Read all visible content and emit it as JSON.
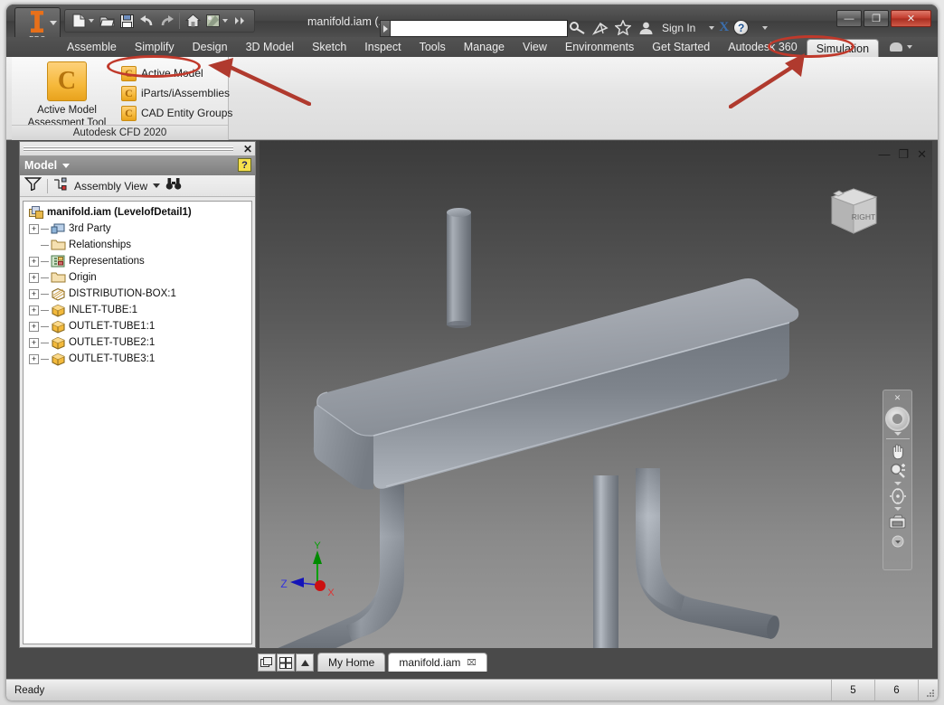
{
  "window": {
    "document_title": "manifold.iam (...",
    "app_button_label": "PRO",
    "minimize": "—",
    "maximize": "❐",
    "close": "✕"
  },
  "quick_access": {
    "items": [
      {
        "name": "new-file-icon",
        "label": "New"
      },
      {
        "name": "open-file-icon",
        "label": "Open"
      },
      {
        "name": "save-icon",
        "label": "Save"
      },
      {
        "name": "undo-icon",
        "label": "Undo"
      },
      {
        "name": "redo-icon",
        "label": "Redo"
      },
      {
        "name": "home-icon",
        "label": "Home"
      },
      {
        "name": "appearance-icon",
        "label": "Appearance"
      },
      {
        "name": "more-commands-icon",
        "label": "More"
      }
    ]
  },
  "search": {
    "value": "",
    "placeholder": ""
  },
  "toolbar_right": {
    "search_icon": "search-key-icon",
    "satellite_icon": "satellite-icon",
    "favorites_icon": "star-icon",
    "sign_in_label": "Sign In",
    "exchange_icon": "autodesk-exchange-icon",
    "help_label": "?"
  },
  "ribbon": {
    "tabs": [
      {
        "label": "Assemble",
        "active": false
      },
      {
        "label": "Simplify",
        "active": false
      },
      {
        "label": "Design",
        "active": false
      },
      {
        "label": "3D Model",
        "active": false
      },
      {
        "label": "Sketch",
        "active": false
      },
      {
        "label": "Inspect",
        "active": false
      },
      {
        "label": "Tools",
        "active": false
      },
      {
        "label": "Manage",
        "active": false
      },
      {
        "label": "View",
        "active": false
      },
      {
        "label": "Environments",
        "active": false
      },
      {
        "label": "Get Started",
        "active": false
      },
      {
        "label": "Autodesk 360",
        "active": false
      },
      {
        "label": "Simulation",
        "active": true
      }
    ],
    "panel": {
      "caption": "Autodesk CFD 2020",
      "big_button": {
        "label_line1": "Active Model",
        "label_line2": "Assessment Tool",
        "icon": "cfd-c-icon"
      },
      "small_buttons": [
        {
          "label": "Active Model",
          "icon": "cfd-c-icon"
        },
        {
          "label": "iParts/iAssemblies",
          "icon": "cfd-c-icon"
        },
        {
          "label": "CAD Entity Groups",
          "icon": "cfd-c-icon"
        }
      ]
    }
  },
  "browser": {
    "title": "Model",
    "help_label": "?",
    "close_label": "✕",
    "toolbar": {
      "filter_icon": "filter-funnel-icon",
      "view_label": "Assembly View",
      "view_icon": "assembly-view-icon",
      "find_icon": "binoculars-find-icon"
    },
    "tree": [
      {
        "label": "manifold.iam (LevelofDetail1)",
        "icon": "assembly-icon",
        "expandable": false,
        "root": true
      },
      {
        "label": "3rd Party",
        "icon": "third-party-icon",
        "expandable": true,
        "root": false
      },
      {
        "label": "Relationships",
        "icon": "folder-icon",
        "expandable": false,
        "root": false
      },
      {
        "label": "Representations",
        "icon": "representations-icon",
        "expandable": true,
        "root": false
      },
      {
        "label": "Origin",
        "icon": "folder-icon",
        "expandable": true,
        "root": false
      },
      {
        "label": "DISTRIBUTION-BOX:1",
        "icon": "part-shaded-icon",
        "expandable": true,
        "root": false
      },
      {
        "label": "INLET-TUBE:1",
        "icon": "part-icon",
        "expandable": true,
        "root": false
      },
      {
        "label": "OUTLET-TUBE1:1",
        "icon": "part-icon",
        "expandable": true,
        "root": false
      },
      {
        "label": "OUTLET-TUBE2:1",
        "icon": "part-icon",
        "expandable": true,
        "root": false
      },
      {
        "label": "OUTLET-TUBE3:1",
        "icon": "part-icon",
        "expandable": true,
        "root": false
      }
    ]
  },
  "viewport": {
    "window_buttons": {
      "minimize": "—",
      "restore": "❐",
      "close": "✕"
    },
    "viewcube_face": "RIGHT",
    "axis": {
      "x": "X",
      "y": "Y",
      "z": "Z"
    },
    "nav_bar": {
      "close_label": "✕",
      "items": [
        {
          "name": "steering-wheel-icon"
        },
        {
          "name": "pan-hand-icon"
        },
        {
          "name": "zoom-magnifier-icon"
        },
        {
          "name": "orbit-icon"
        },
        {
          "name": "look-camera-icon"
        },
        {
          "name": "nav-options-icon"
        }
      ]
    },
    "model_name": "manifold-assembly-3d-model",
    "background_top_color": "#3b3b3b",
    "background_bottom_color": "#9a9a9a",
    "part_color": "#8d9299"
  },
  "doc_tabs": {
    "buttons": [
      {
        "name": "cascade-windows-icon"
      },
      {
        "name": "tile-windows-icon"
      },
      {
        "name": "tab-scroll-up-icon"
      }
    ],
    "tabs": [
      {
        "label": "My Home",
        "active": false,
        "closable": false
      },
      {
        "label": "manifold.iam",
        "active": true,
        "closable": true,
        "close_label": "⌧"
      }
    ]
  },
  "status_bar": {
    "message": "Ready",
    "cell1": "5",
    "cell2": "6"
  },
  "annotations": {
    "accent_color": "#c0392b",
    "highlights": [
      {
        "name": "active-model-highlight",
        "target": "Active Model"
      },
      {
        "name": "simulation-tab-highlight",
        "target": "Simulation"
      }
    ],
    "arrows": [
      {
        "name": "arrow-to-active-model"
      },
      {
        "name": "arrow-to-simulation-tab"
      }
    ]
  }
}
